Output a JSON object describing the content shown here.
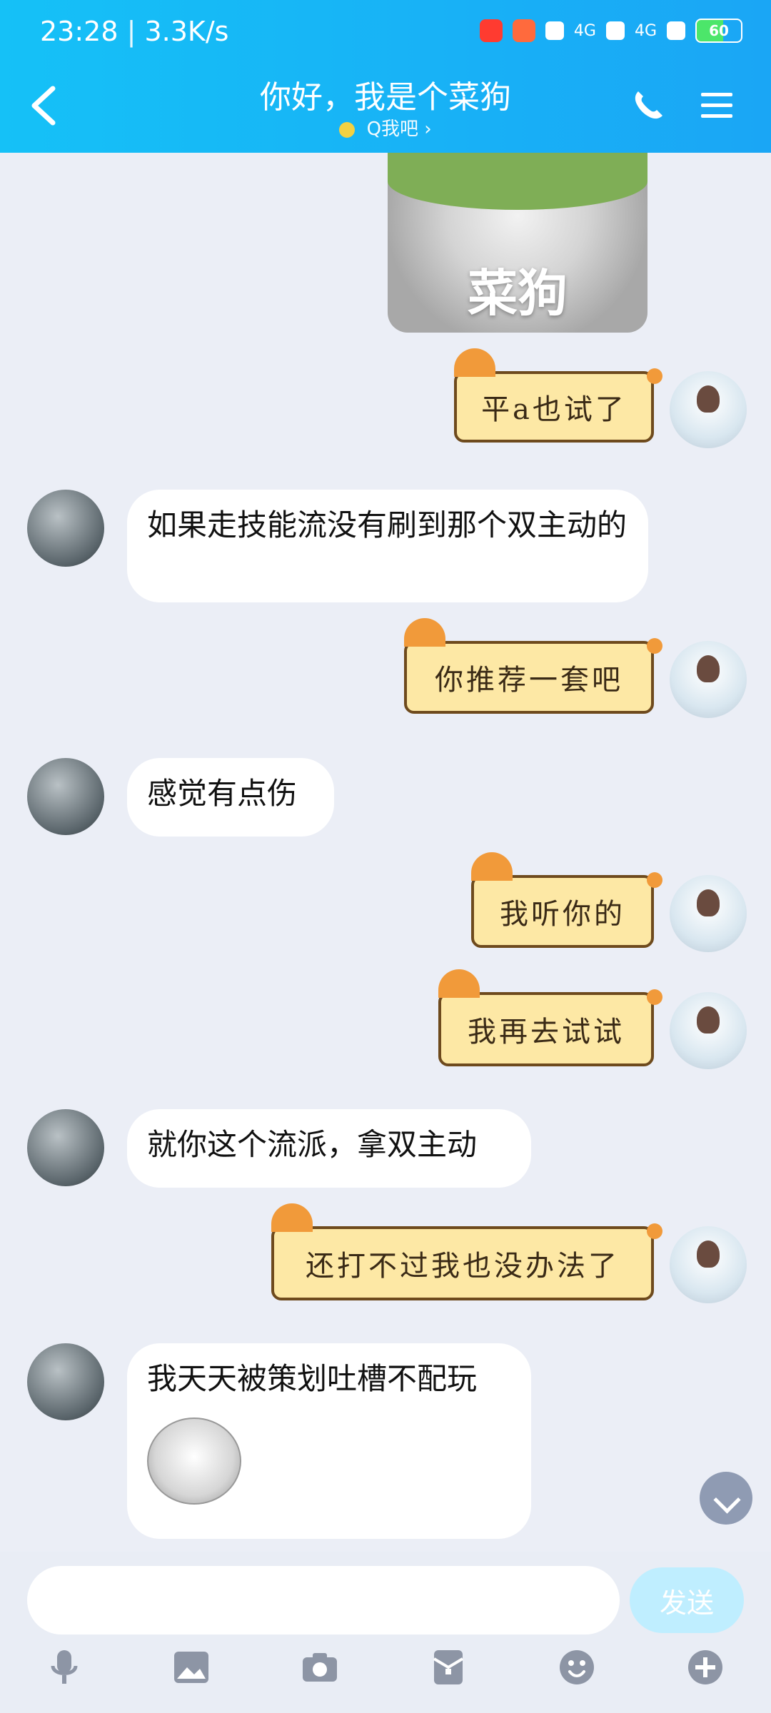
{
  "status_bar": {
    "time": "23:28",
    "speed": "3.3K/s",
    "network_1": "4G",
    "network_2": "4G",
    "battery": "60"
  },
  "header": {
    "title": "你好，我是个菜狗",
    "subtitle": "Q我吧"
  },
  "chat": {
    "image_caption": "菜狗",
    "messages": [
      {
        "side": "right",
        "text": "平a也试了"
      },
      {
        "side": "left",
        "text": "如果走技能流没有刷到那个双主动的"
      },
      {
        "side": "right",
        "text": "你推荐一套吧"
      },
      {
        "side": "left",
        "text": "感觉有点伤"
      },
      {
        "side": "right",
        "text": "我听你的"
      },
      {
        "side": "right",
        "text": "我再去试试"
      },
      {
        "side": "left",
        "text": "就你这个流派，拿双主动"
      },
      {
        "side": "right",
        "text": "还打不过我也没办法了"
      },
      {
        "side": "left",
        "text": "我天天被策划吐槽不配玩"
      }
    ]
  },
  "input": {
    "send_label": "发送"
  },
  "icons": [
    "mic-icon",
    "image-icon",
    "camera-icon",
    "red-packet-icon",
    "emoji-icon",
    "plus-icon"
  ],
  "colors": {
    "header_gradient_start": "#15c1f7",
    "header_gradient_end": "#1aa6f5",
    "cat_bubble": "#fde8a5"
  }
}
